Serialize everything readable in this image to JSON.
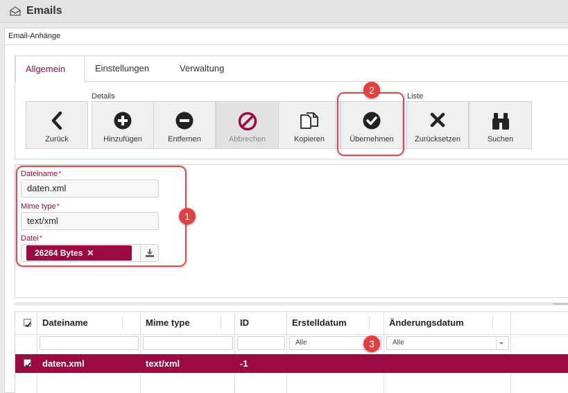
{
  "app": {
    "title": "Emails"
  },
  "window": {
    "title": "Email-Anhänge"
  },
  "tabs": [
    {
      "label": "Allgemein",
      "active": true
    },
    {
      "label": "Einstellungen",
      "active": false
    },
    {
      "label": "Verwaltung",
      "active": false
    }
  ],
  "toolbar": {
    "group_details": "Details",
    "group_liste": "Liste",
    "back": "Zurück",
    "add": "Hinzufügen",
    "remove": "Entfernen",
    "cancel": "Abbrechen",
    "copy": "Kopieren",
    "apply": "Übernehmen",
    "reset": "Zurücksetzen",
    "search": "Suchen"
  },
  "form": {
    "filename_label": "Dateiname",
    "filename_value": "daten.xml",
    "mime_label": "Mime type",
    "mime_value": "text/xml",
    "file_label": "Datei",
    "file_chip": "26264 Bytes",
    "required_mark": "*"
  },
  "callouts": {
    "one": "1",
    "two": "2",
    "three": "3"
  },
  "grid": {
    "columns": [
      "Dateiname",
      "Mime type",
      "ID",
      "Erstelldatum",
      "Änderungsdatum"
    ],
    "filter_all": "Alle",
    "rows": [
      {
        "filename": "daten.xml",
        "mime": "text/xml",
        "id": "-1",
        "created": "",
        "modified": ""
      }
    ]
  },
  "colors": {
    "accent": "#9b0a43",
    "callout": "#e04040"
  }
}
